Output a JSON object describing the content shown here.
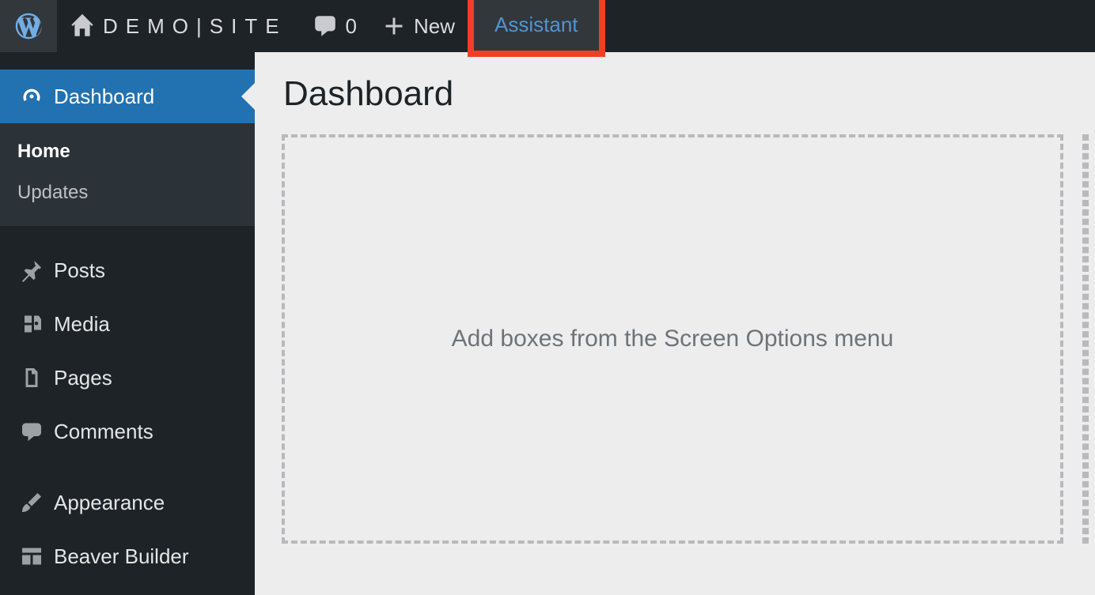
{
  "adminbar": {
    "site_name": "DEMO|SITE",
    "comments_count": "0",
    "new_label": "New",
    "assistant_label": "Assistant"
  },
  "sidebar": {
    "dashboard": {
      "label": "Dashboard",
      "submenu": {
        "home": "Home",
        "updates": "Updates"
      }
    },
    "posts": "Posts",
    "media": "Media",
    "pages": "Pages",
    "comments": "Comments",
    "appearance": "Appearance",
    "beaver_builder": "Beaver Builder"
  },
  "content": {
    "title": "Dashboard",
    "empty_placeholder": "Add boxes from the Screen Options menu"
  }
}
